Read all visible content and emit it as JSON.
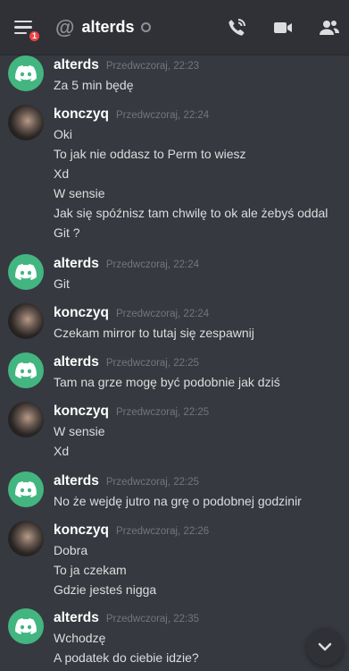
{
  "header": {
    "badge_count": "1",
    "at_symbol": "@",
    "title": "alterds",
    "icons": [
      "hamburger-menu-icon",
      "phone-call-icon",
      "video-call-icon",
      "members-icon"
    ]
  },
  "messages": [
    {
      "author": "alterds",
      "timestamp": "Przedwczoraj, 22:23",
      "lines": [
        "Za 5 min będę"
      ]
    },
    {
      "author": "konczyq",
      "timestamp": "Przedwczoraj, 22:24",
      "lines": [
        "Oki",
        "To jak nie oddasz to Perm to wiesz",
        "Xd",
        "W sensie",
        "Jak się spóźnisz tam chwilę to ok ale żebyś oddal",
        "Git ?"
      ]
    },
    {
      "author": "alterds",
      "timestamp": "Przedwczoraj, 22:24",
      "lines": [
        "Git"
      ]
    },
    {
      "author": "konczyq",
      "timestamp": "Przedwczoraj, 22:24",
      "lines": [
        "Czekam mirror to tutaj się zespawnij"
      ]
    },
    {
      "author": "alterds",
      "timestamp": "Przedwczoraj, 22:25",
      "lines": [
        "Tam na grze mogę być podobnie jak dziś"
      ]
    },
    {
      "author": "konczyq",
      "timestamp": "Przedwczoraj, 22:25",
      "lines": [
        "W sensie",
        "Xd"
      ]
    },
    {
      "author": "alterds",
      "timestamp": "Przedwczoraj, 22:25",
      "lines": [
        "No że wejdę jutro na grę o podobnej godzinir"
      ]
    },
    {
      "author": "konczyq",
      "timestamp": "Przedwczoraj, 22:26",
      "lines": [
        "Dobra",
        "To ja czekam",
        "Gdzie jesteś nigga"
      ]
    },
    {
      "author": "alterds",
      "timestamp": "Przedwczoraj, 22:35",
      "lines": [
        "Wchodzę",
        "A podatek do ciebie idzie?"
      ]
    }
  ],
  "colors": {
    "background": "#36393f",
    "header": "#2f3136",
    "discord_avatar": "#43b581",
    "badge": "#ed4245",
    "author": "#ffffff",
    "timestamp": "#72767d",
    "text": "#dcddde"
  }
}
